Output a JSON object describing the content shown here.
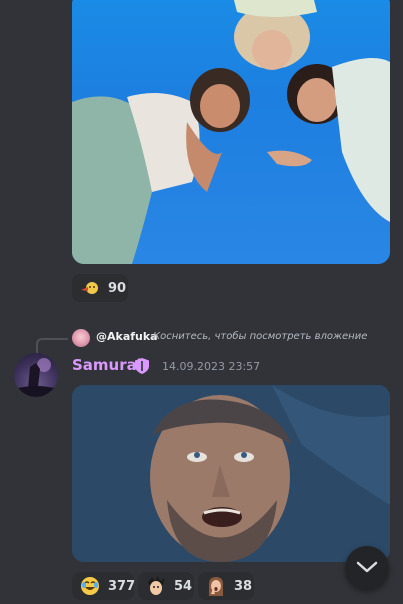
{
  "message1": {
    "reactions": [
      {
        "icon": "face-emoji-icon",
        "count": "90"
      }
    ]
  },
  "message2": {
    "reply": {
      "name": "@Akafuka",
      "text": "Коснитесь, чтобы посмотреть вложение"
    },
    "author": "Samurai",
    "timestamp": "14.09.2023 23:57",
    "name_color": "#d999ff",
    "reactions": [
      {
        "icon": "laughing-crying-emoji-icon",
        "count": "377"
      },
      {
        "icon": "anime-face-emoji-icon",
        "count": "54"
      },
      {
        "icon": "shocked-person-emoji-icon",
        "count": "38"
      }
    ]
  },
  "colors": {
    "background": "#313338",
    "reaction_bg": "#2b2d31",
    "muted_text": "#949ba4"
  }
}
